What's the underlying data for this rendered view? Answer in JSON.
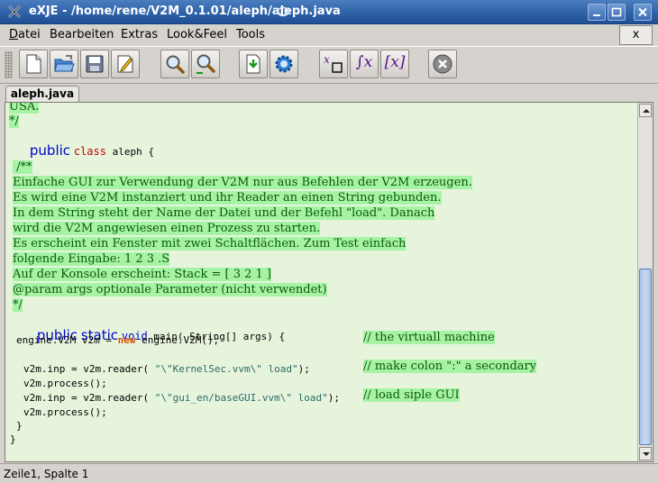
{
  "window": {
    "title": "eXJE - /home/rene/V2M_0.1.01/aleph/aleph.java"
  },
  "menu": {
    "items": [
      {
        "first": "D",
        "rest": "atei"
      },
      {
        "first": "",
        "rest": "Bearbeiten"
      },
      {
        "first": "",
        "rest": "Extras"
      },
      {
        "first": "",
        "rest": "Look&Feel"
      },
      {
        "first": "",
        "rest": "Tools"
      }
    ],
    "close_label": "x"
  },
  "toolbar": {
    "icons": [
      "new-file-icon",
      "open-folder-icon",
      "save-icon",
      "edit-document-icon",
      "search-icon",
      "search-replace-icon",
      "download-document-icon",
      "settings-gear-icon",
      "subscript-icon",
      "integral-icon",
      "bracket-x-icon",
      "stop-icon"
    ],
    "integral_label": "∫x",
    "bracket_label": "[x]"
  },
  "tabs": [
    {
      "label": "aleph.java",
      "active": true
    }
  ],
  "editor": {
    "lines": {
      "l0": "USA.",
      "l1": "*/",
      "l2_kw": "public",
      "l2_kw2": "class",
      "l2_rest": " aleph {",
      "l4": " /**",
      "l5": "Einfache GUI zur Verwendung der V2M nur aus Befehlen der V2M erzeugen.",
      "l6": "Es wird eine V2M instanziert und ihr Reader an einen String gebunden.",
      "l7": "In dem String steht der Name der Datei und der Befehl \"load\". Danach",
      "l8": "wird die V2M angewiesen einen Prozess zu starten.",
      "l9": "Es erscheint ein Fenster mit zwei Schaltflächen. Zum Test einfach",
      "l10": "folgende Eingabe: 1 2 3 .S",
      "l11": "Auf der Konsole erscheint: Stack = [ 3 2 1 ]",
      "l12": "@param args optionale Parameter (nicht verwendet)",
      "l13": "*/",
      "l14_kw1": "public",
      "l14_kw2": "static",
      "l14_kw3": "void",
      "l14_rest": " main( String[] args) {",
      "l15_a": "engine.V2M v2m = ",
      "l15_new": "new",
      "l15_b": " engine.V2M();",
      "l15_comment": "// the virtuall machine",
      "l16_a": "v2m.inp = v2m.reader( ",
      "l16_str": "\"\\\"KernelSec.vvm\\\" load\"",
      "l16_b": ");",
      "l16_comment": "// make colon \":\" a secondary",
      "l17": "v2m.process();",
      "l18_a": "v2m.inp = v2m.reader( ",
      "l18_str": "\"\\\"gui_en/baseGUI.vvm\\\" load\"",
      "l18_b": ");",
      "l18_comment": "// load siple GUI",
      "l19": "v2m.process();",
      "l20": "}",
      "l21": "}"
    }
  },
  "statusbar": {
    "position": "Zeile1, Spalte 1"
  },
  "colors": {
    "editor_bg": "#e6f4dc",
    "highlight": "#a6f3a6",
    "keyword": "#0000c8",
    "comment": "#0a5a0a",
    "titlebar": "#2f62a8"
  }
}
